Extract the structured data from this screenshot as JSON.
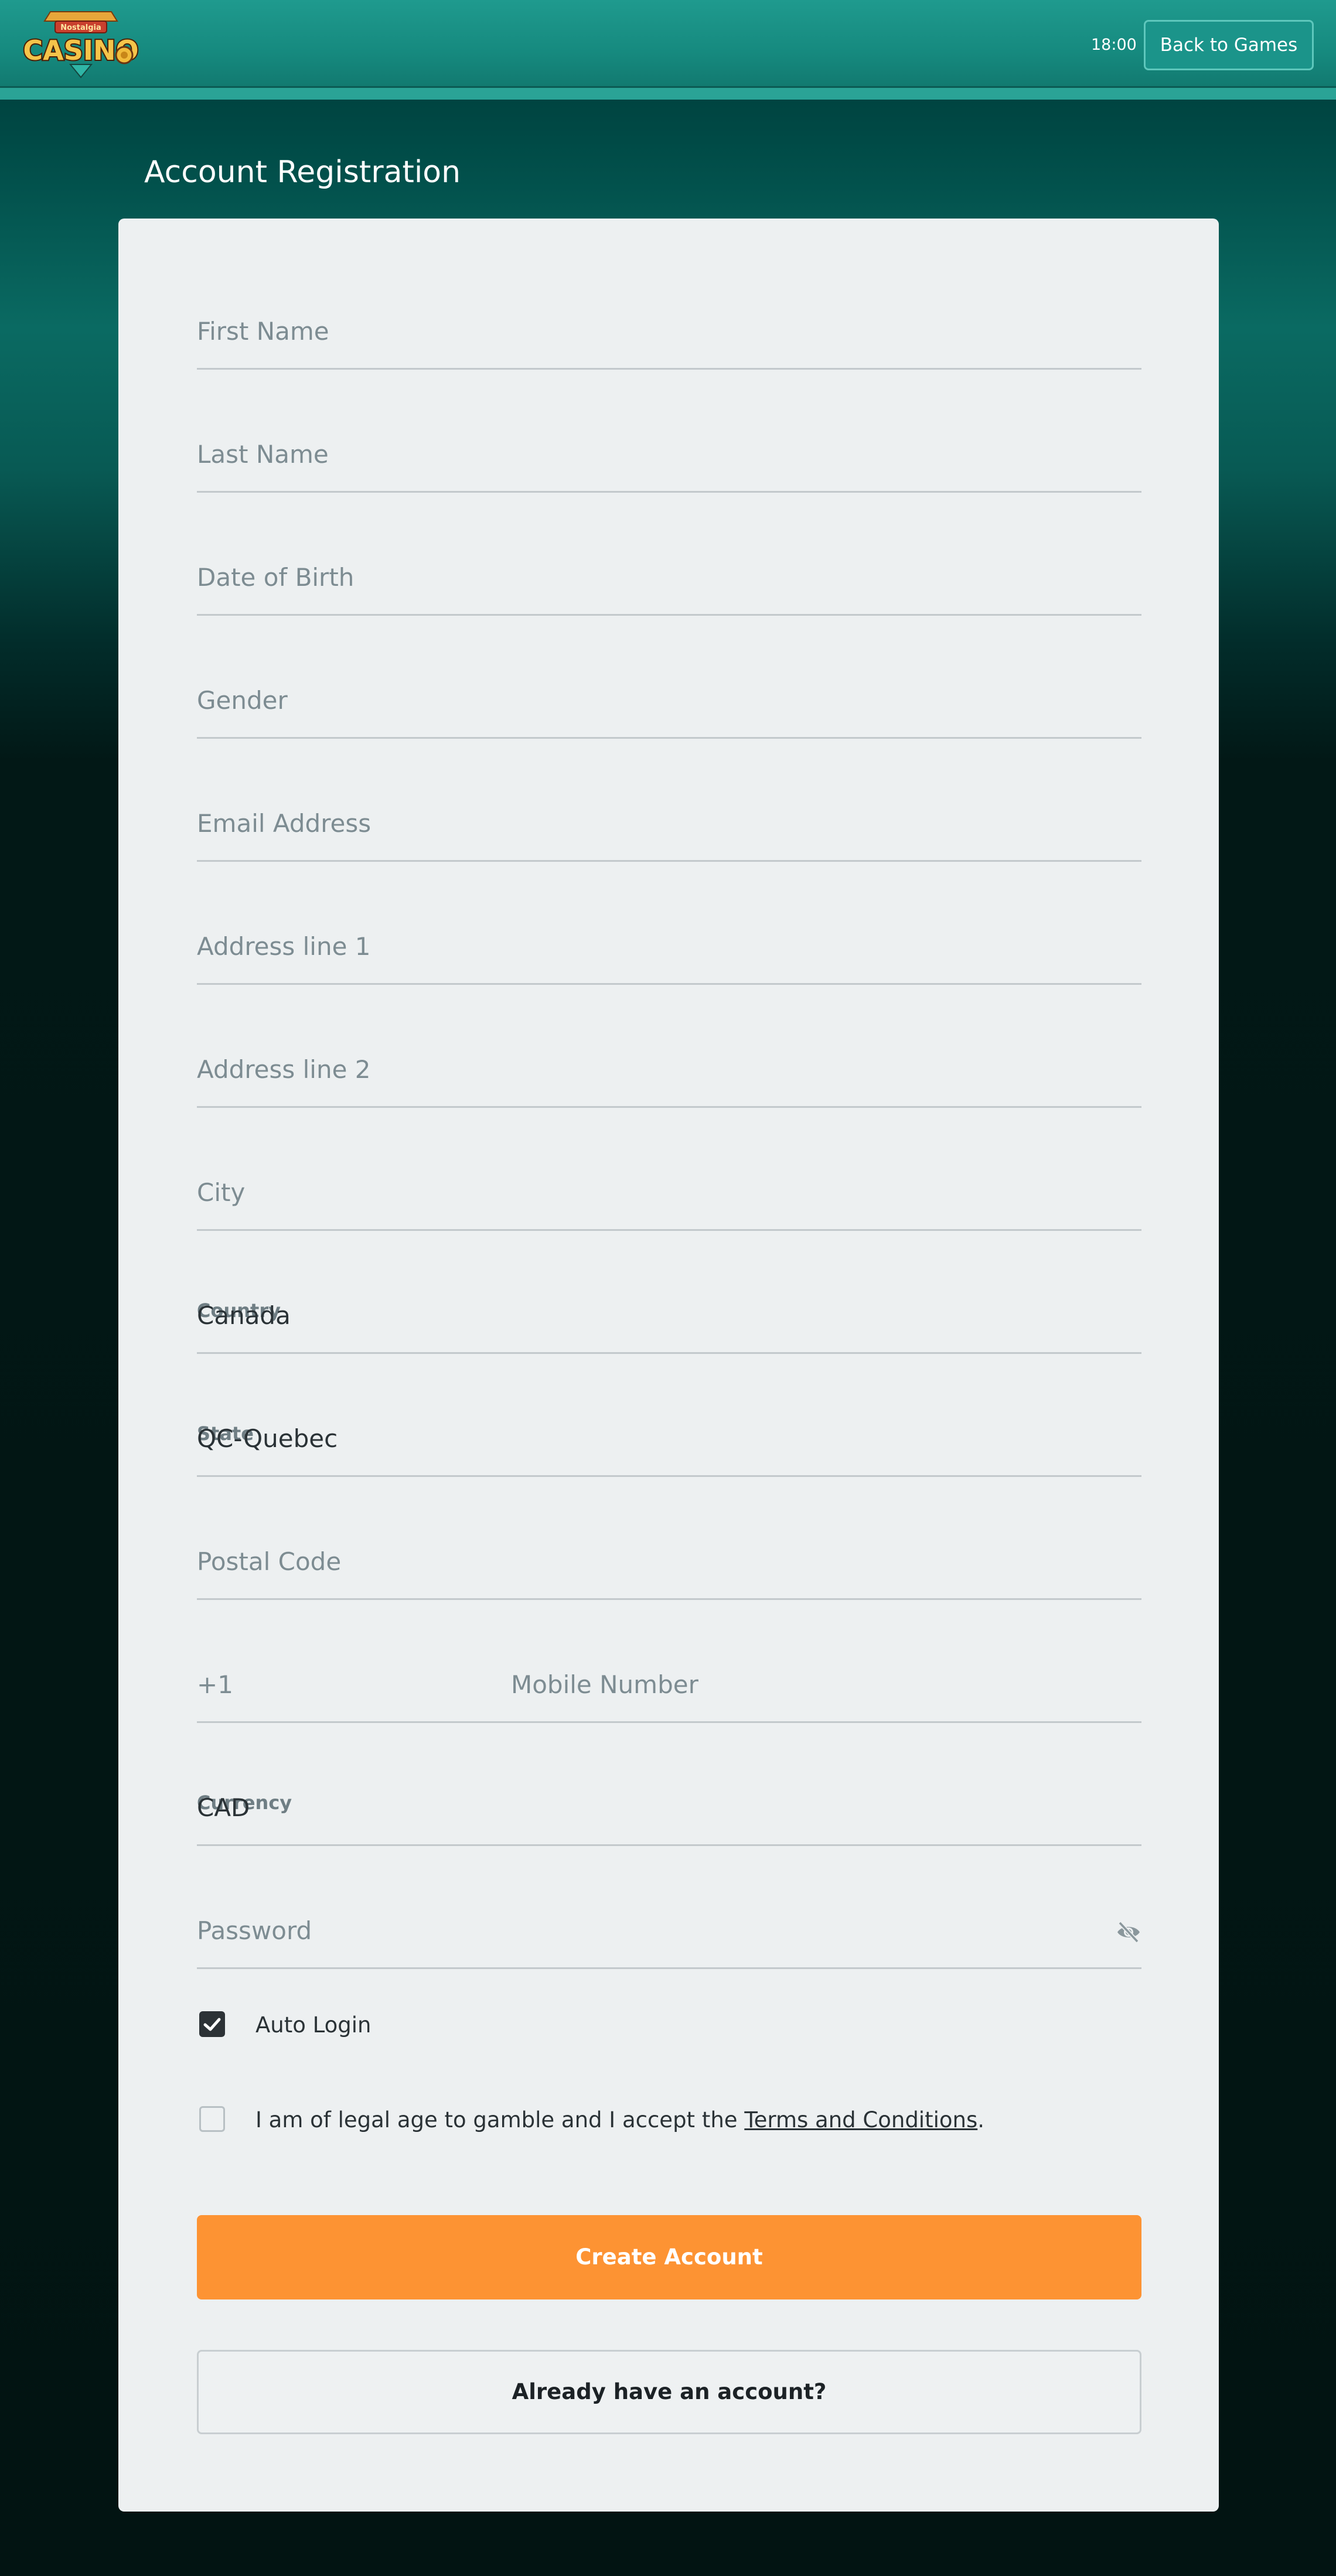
{
  "header": {
    "logo_top": "Nostalgia",
    "logo_main": "CASINO",
    "clock": "18:00",
    "back_label": "Back to Games"
  },
  "page": {
    "title": "Account Registration"
  },
  "form": {
    "first_name": "First Name",
    "last_name": "Last Name",
    "dob": "Date of Birth",
    "gender": "Gender",
    "email": "Email Address",
    "address1": "Address line 1",
    "address2": "Address line 2",
    "city": "City",
    "country_label": "Country",
    "country_value": "Canada",
    "state_label": "State",
    "state_value": "QC-Quebec",
    "postal": "Postal Code",
    "phone_prefix": "+1",
    "mobile": "Mobile Number",
    "currency_label": "Currency",
    "currency_value": "CAD",
    "password": "Password",
    "auto_login": "Auto Login",
    "auto_login_checked": true,
    "terms_prefix": "I am of legal age to gamble and I accept the ",
    "terms_link": "Terms and Conditions",
    "terms_suffix": ".",
    "terms_checked": false
  },
  "actions": {
    "create": "Create Account",
    "login": "Already have an account?"
  },
  "colors": {
    "header": "#1f9a8e",
    "card": "#edf0f1",
    "primary": "#fd9333"
  }
}
